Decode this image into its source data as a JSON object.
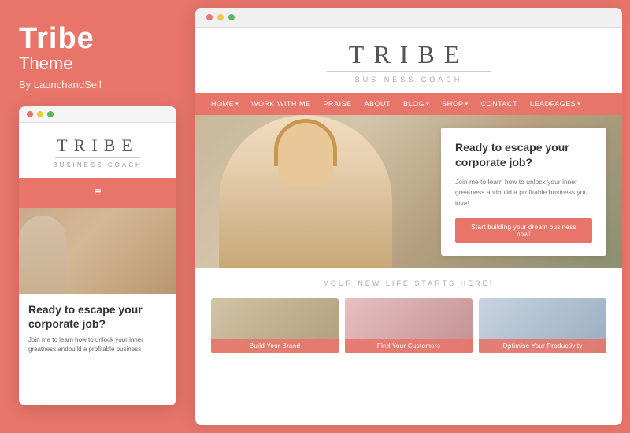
{
  "left": {
    "title": "Tribe",
    "subtitle": "Theme",
    "author": "By LaunchandSell"
  },
  "mobile": {
    "logo": {
      "main": "TRIBE",
      "sub": "BUSINESS COACH"
    },
    "hero_title": "Ready to escape your corporate job?",
    "hero_text": "Join me to learn how to unlock your inner greatness andbuild a profitable business"
  },
  "desktop": {
    "logo": {
      "main": "TRIBE",
      "sub": "BUSINESS COACH"
    },
    "nav": {
      "items": [
        {
          "label": "HOME",
          "has_arrow": true
        },
        {
          "label": "WORK WITH ME",
          "has_arrow": false
        },
        {
          "label": "PRAISE",
          "has_arrow": false
        },
        {
          "label": "ABOUT",
          "has_arrow": false
        },
        {
          "label": "BLOG",
          "has_arrow": true
        },
        {
          "label": "SHOP",
          "has_arrow": true
        },
        {
          "label": "CONTACT",
          "has_arrow": false
        },
        {
          "label": "LEADPAGES",
          "has_arrow": true
        }
      ]
    },
    "hero": {
      "title": "Ready to escape your corporate job?",
      "text": "Join me to learn how to unlock your inner greatness andbuild a profitable business you love!",
      "cta_label": "Start building your dream business now!"
    },
    "bottom": {
      "tagline": "YOUR NEW LIFE STARTS HERE!",
      "cards": [
        {
          "label": "Build Your Brand",
          "bg_class": "card-bg-1"
        },
        {
          "label": "Find Your Customers",
          "bg_class": "card-bg-2"
        },
        {
          "label": "Optimise Your Productivity",
          "bg_class": "card-bg-3"
        }
      ]
    }
  },
  "colors": {
    "accent": "#e8756a",
    "white": "#ffffff",
    "text_dark": "#333333",
    "text_mid": "#777777",
    "text_light": "#aaaaaa"
  },
  "dots": {
    "red": "#e8756a",
    "yellow": "#f5c842",
    "green": "#5cb85c"
  }
}
